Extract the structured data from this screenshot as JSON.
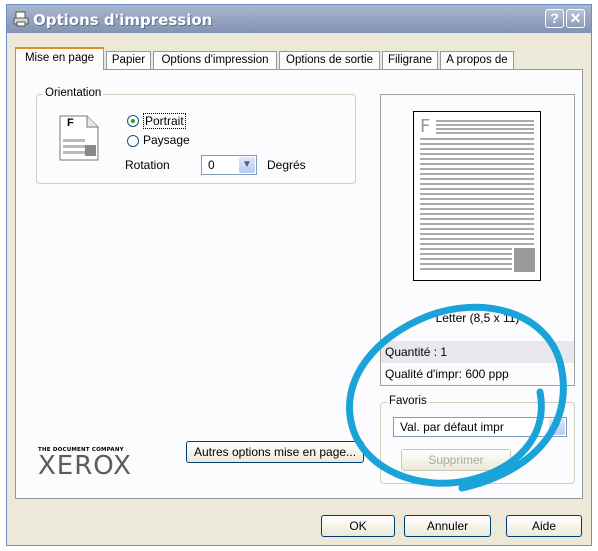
{
  "window": {
    "title": "Options d'impression",
    "help_glyph": "?",
    "close_glyph": "✕"
  },
  "tabs": [
    {
      "label": "Mise en page"
    },
    {
      "label": "Papier"
    },
    {
      "label": "Options d'impression"
    },
    {
      "label": "Options de sortie"
    },
    {
      "label": "Filigrane"
    },
    {
      "label": "A propos de"
    }
  ],
  "orientation": {
    "group_label": "Orientation",
    "portrait_label": "Portrait",
    "landscape_label": "Paysage",
    "rotation_label": "Rotation",
    "rotation_value": "0",
    "degrees_label": "Degrés",
    "icon_letter": "F"
  },
  "preview": {
    "paper_letter": "F",
    "paper_size": "Letter (8,5 x 11)",
    "quantity": "Quantité : 1",
    "quality": "Qualité d'impr: 600 ppp"
  },
  "favorites": {
    "group_label": "Favoris",
    "selected": "Val. par défaut impr",
    "delete_label": "Supprimer"
  },
  "buttons": {
    "more_layout": "Autres options mise en page...",
    "ok": "OK",
    "cancel": "Annuler",
    "help": "Aide"
  },
  "brand": {
    "tagline": "THE DOCUMENT COMPANY",
    "name": "XEROX"
  },
  "colors": {
    "accent_tab": "#e68b2c",
    "annotation": "#1aa3d8"
  }
}
